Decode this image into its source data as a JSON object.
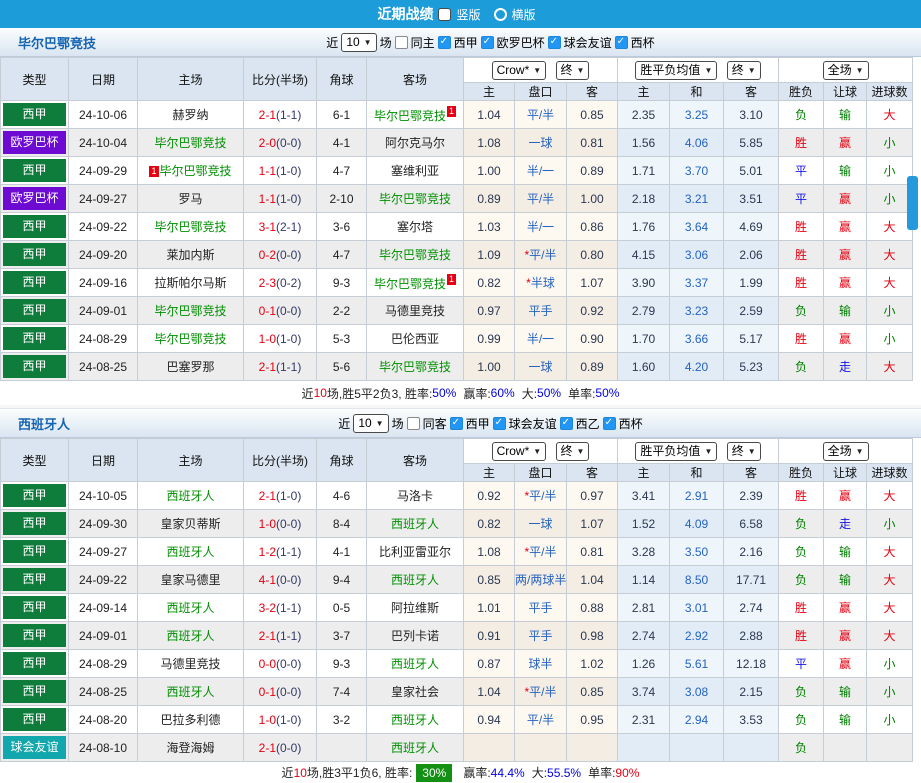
{
  "colors": {
    "type": {
      "西甲": "#0e7c3b",
      "欧罗巴杯": "#6d0bd3",
      "球会友谊": "#12a7ac"
    },
    "result": {
      "胜": "#e60012",
      "平": "#1414e6",
      "负": "#008000",
      "赢": "#e60012",
      "走": "#1414e6",
      "输": "#008000",
      "大": "#e60012",
      "小": "#008000"
    },
    "topbar": "#1c9cd8",
    "checkbox": "#2196f3",
    "team_self": "#009000"
  },
  "topbar": {
    "title": "近期战绩",
    "options": [
      {
        "label": "竖版",
        "selected": true
      },
      {
        "label": "横版",
        "selected": false
      }
    ]
  },
  "table_head": {
    "type": "类型",
    "date": "日期",
    "home": "主场",
    "score": "比分(半场)",
    "corner": "角球",
    "away": "客场",
    "odds_home": "主",
    "odds_handicap": "盘口",
    "odds_away": "客",
    "avg_home": "主",
    "avg_draw": "和",
    "avg_away": "客",
    "res_wdl": "胜负",
    "res_handicap": "让球",
    "res_goals": "进球数"
  },
  "sections": [
    {
      "team": "毕尔巴鄂竞技",
      "filters": {
        "near": "近",
        "count": "10",
        "games": "场",
        "same": "同主",
        "leagues": [
          "西甲",
          "欧罗巴杯",
          "球会友谊",
          "西杯"
        ]
      },
      "selects": {
        "odds": "Crow*",
        "odds_term": "终",
        "avg": "胜平负均值",
        "avg_term": "终",
        "scope": "全场"
      },
      "rows": [
        {
          "type": "西甲",
          "date": "24-10-06",
          "home": "赫罗纳",
          "hs": false,
          "hm": "",
          "score": "2-1",
          "half": "(1-1)",
          "corner": "6-1",
          "away": "毕尔巴鄂竞技",
          "as": true,
          "am": "1",
          "oh": "1.04",
          "hc": "平/半",
          "star": false,
          "oa": "0.85",
          "ah": "2.35",
          "ad": "3.25",
          "aa": "3.10",
          "r1": "负",
          "r2": "输",
          "r3": "大"
        },
        {
          "type": "欧罗巴杯",
          "date": "24-10-04",
          "home": "毕尔巴鄂竞技",
          "hs": true,
          "hm": "",
          "score": "2-0",
          "half": "(0-0)",
          "corner": "4-1",
          "away": "阿尔克马尔",
          "as": false,
          "am": "",
          "oh": "1.08",
          "hc": "一球",
          "star": false,
          "oa": "0.81",
          "ah": "1.56",
          "ad": "4.06",
          "aa": "5.85",
          "r1": "胜",
          "r2": "赢",
          "r3": "小"
        },
        {
          "type": "西甲",
          "date": "24-09-29",
          "home": "毕尔巴鄂竞技",
          "hs": true,
          "hm": "1",
          "score": "1-1",
          "half": "(1-0)",
          "corner": "4-7",
          "away": "塞维利亚",
          "as": false,
          "am": "",
          "oh": "1.00",
          "hc": "半/一",
          "star": false,
          "oa": "0.89",
          "ah": "1.71",
          "ad": "3.70",
          "aa": "5.01",
          "r1": "平",
          "r2": "输",
          "r3": "小"
        },
        {
          "type": "欧罗巴杯",
          "date": "24-09-27",
          "home": "罗马",
          "hs": false,
          "hm": "",
          "score": "1-1",
          "half": "(1-0)",
          "corner": "2-10",
          "away": "毕尔巴鄂竞技",
          "as": true,
          "am": "",
          "oh": "0.89",
          "hc": "平/半",
          "star": false,
          "oa": "1.00",
          "ah": "2.18",
          "ad": "3.21",
          "aa": "3.51",
          "r1": "平",
          "r2": "赢",
          "r3": "小"
        },
        {
          "type": "西甲",
          "date": "24-09-22",
          "home": "毕尔巴鄂竞技",
          "hs": true,
          "hm": "",
          "score": "3-1",
          "half": "(2-1)",
          "corner": "3-6",
          "away": "塞尔塔",
          "as": false,
          "am": "",
          "oh": "1.03",
          "hc": "半/一",
          "star": false,
          "oa": "0.86",
          "ah": "1.76",
          "ad": "3.64",
          "aa": "4.69",
          "r1": "胜",
          "r2": "赢",
          "r3": "大"
        },
        {
          "type": "西甲",
          "date": "24-09-20",
          "home": "莱加内斯",
          "hs": false,
          "hm": "",
          "score": "0-2",
          "half": "(0-0)",
          "corner": "4-7",
          "away": "毕尔巴鄂竞技",
          "as": true,
          "am": "",
          "oh": "1.09",
          "hc": "平/半",
          "star": true,
          "oa": "0.80",
          "ah": "4.15",
          "ad": "3.06",
          "aa": "2.06",
          "r1": "胜",
          "r2": "赢",
          "r3": "大"
        },
        {
          "type": "西甲",
          "date": "24-09-16",
          "home": "拉斯帕尔马斯",
          "hs": false,
          "hm": "",
          "score": "2-3",
          "half": "(0-2)",
          "corner": "9-3",
          "away": "毕尔巴鄂竞技",
          "as": true,
          "am": "1",
          "oh": "0.82",
          "hc": "半球",
          "star": true,
          "oa": "1.07",
          "ah": "3.90",
          "ad": "3.37",
          "aa": "1.99",
          "r1": "胜",
          "r2": "赢",
          "r3": "大"
        },
        {
          "type": "西甲",
          "date": "24-09-01",
          "home": "毕尔巴鄂竞技",
          "hs": true,
          "hm": "",
          "score": "0-1",
          "half": "(0-0)",
          "corner": "2-2",
          "away": "马德里竞技",
          "as": false,
          "am": "",
          "oh": "0.97",
          "hc": "平手",
          "star": false,
          "oa": "0.92",
          "ah": "2.79",
          "ad": "3.23",
          "aa": "2.59",
          "r1": "负",
          "r2": "输",
          "r3": "小"
        },
        {
          "type": "西甲",
          "date": "24-08-29",
          "home": "毕尔巴鄂竞技",
          "hs": true,
          "hm": "",
          "score": "1-0",
          "half": "(1-0)",
          "corner": "5-3",
          "away": "巴伦西亚",
          "as": false,
          "am": "",
          "oh": "0.99",
          "hc": "半/一",
          "star": false,
          "oa": "0.90",
          "ah": "1.70",
          "ad": "3.66",
          "aa": "5.17",
          "r1": "胜",
          "r2": "赢",
          "r3": "小"
        },
        {
          "type": "西甲",
          "date": "24-08-25",
          "home": "巴塞罗那",
          "hs": false,
          "hm": "",
          "score": "2-1",
          "half": "(1-1)",
          "corner": "5-6",
          "away": "毕尔巴鄂竞技",
          "as": true,
          "am": "",
          "oh": "1.00",
          "hc": "一球",
          "star": false,
          "oa": "0.89",
          "ah": "1.60",
          "ad": "4.20",
          "aa": "5.23",
          "r1": "负",
          "r2": "走",
          "r3": "大"
        }
      ],
      "summary": {
        "near": "近",
        "count": "10",
        "rest": "场,胜5平2负3, 胜率:",
        "win_rate": "50%",
        "win_rate_badge": false,
        "win_label": "赢率:",
        "win_pct": "60%",
        "big_label": "大:",
        "big_pct": "50%",
        "single_label": "单率:",
        "single_pct": "50%",
        "single_red": false
      }
    },
    {
      "team": "西班牙人",
      "filters": {
        "near": "近",
        "count": "10",
        "games": "场",
        "same": "同客",
        "leagues": [
          "西甲",
          "球会友谊",
          "西乙",
          "西杯"
        ]
      },
      "selects": {
        "odds": "Crow*",
        "odds_term": "终",
        "avg": "胜平负均值",
        "avg_term": "终",
        "scope": "全场"
      },
      "rows": [
        {
          "type": "西甲",
          "date": "24-10-05",
          "home": "西班牙人",
          "hs": true,
          "hm": "",
          "score": "2-1",
          "half": "(1-0)",
          "corner": "4-6",
          "away": "马洛卡",
          "as": false,
          "am": "",
          "oh": "0.92",
          "hc": "平/半",
          "star": true,
          "oa": "0.97",
          "ah": "3.41",
          "ad": "2.91",
          "aa": "2.39",
          "r1": "胜",
          "r2": "赢",
          "r3": "大"
        },
        {
          "type": "西甲",
          "date": "24-09-30",
          "home": "皇家贝蒂斯",
          "hs": false,
          "hm": "",
          "score": "1-0",
          "half": "(0-0)",
          "corner": "8-4",
          "away": "西班牙人",
          "as": true,
          "am": "",
          "oh": "0.82",
          "hc": "一球",
          "star": false,
          "oa": "1.07",
          "ah": "1.52",
          "ad": "4.09",
          "aa": "6.58",
          "r1": "负",
          "r2": "走",
          "r3": "小"
        },
        {
          "type": "西甲",
          "date": "24-09-27",
          "home": "西班牙人",
          "hs": true,
          "hm": "",
          "score": "1-2",
          "half": "(1-1)",
          "corner": "4-1",
          "away": "比利亚雷亚尔",
          "as": false,
          "am": "",
          "oh": "1.08",
          "hc": "平/半",
          "star": true,
          "oa": "0.81",
          "ah": "3.28",
          "ad": "3.50",
          "aa": "2.16",
          "r1": "负",
          "r2": "输",
          "r3": "大"
        },
        {
          "type": "西甲",
          "date": "24-09-22",
          "home": "皇家马德里",
          "hs": false,
          "hm": "",
          "score": "4-1",
          "half": "(0-0)",
          "corner": "9-4",
          "away": "西班牙人",
          "as": true,
          "am": "",
          "oh": "0.85",
          "hc": "两/两球半",
          "star": false,
          "oa": "1.04",
          "ah": "1.14",
          "ad": "8.50",
          "aa": "17.71",
          "r1": "负",
          "r2": "输",
          "r3": "大"
        },
        {
          "type": "西甲",
          "date": "24-09-14",
          "home": "西班牙人",
          "hs": true,
          "hm": "",
          "score": "3-2",
          "half": "(1-1)",
          "corner": "0-5",
          "away": "阿拉维斯",
          "as": false,
          "am": "",
          "oh": "1.01",
          "hc": "平手",
          "star": false,
          "oa": "0.88",
          "ah": "2.81",
          "ad": "3.01",
          "aa": "2.74",
          "r1": "胜",
          "r2": "赢",
          "r3": "大"
        },
        {
          "type": "西甲",
          "date": "24-09-01",
          "home": "西班牙人",
          "hs": true,
          "hm": "",
          "score": "2-1",
          "half": "(1-1)",
          "corner": "3-7",
          "away": "巴列卡诺",
          "as": false,
          "am": "",
          "oh": "0.91",
          "hc": "平手",
          "star": false,
          "oa": "0.98",
          "ah": "2.74",
          "ad": "2.92",
          "aa": "2.88",
          "r1": "胜",
          "r2": "赢",
          "r3": "大"
        },
        {
          "type": "西甲",
          "date": "24-08-29",
          "home": "马德里竞技",
          "hs": false,
          "hm": "",
          "score": "0-0",
          "half": "(0-0)",
          "corner": "9-3",
          "away": "西班牙人",
          "as": true,
          "am": "",
          "oh": "0.87",
          "hc": "球半",
          "star": false,
          "oa": "1.02",
          "ah": "1.26",
          "ad": "5.61",
          "aa": "12.18",
          "r1": "平",
          "r2": "赢",
          "r3": "小"
        },
        {
          "type": "西甲",
          "date": "24-08-25",
          "home": "西班牙人",
          "hs": true,
          "hm": "",
          "score": "0-1",
          "half": "(0-0)",
          "corner": "7-4",
          "away": "皇家社会",
          "as": false,
          "am": "",
          "oh": "1.04",
          "hc": "平/半",
          "star": true,
          "oa": "0.85",
          "ah": "3.74",
          "ad": "3.08",
          "aa": "2.15",
          "r1": "负",
          "r2": "输",
          "r3": "小"
        },
        {
          "type": "西甲",
          "date": "24-08-20",
          "home": "巴拉多利德",
          "hs": false,
          "hm": "",
          "score": "1-0",
          "half": "(1-0)",
          "corner": "3-2",
          "away": "西班牙人",
          "as": true,
          "am": "",
          "oh": "0.94",
          "hc": "平/半",
          "star": false,
          "oa": "0.95",
          "ah": "2.31",
          "ad": "2.94",
          "aa": "3.53",
          "r1": "负",
          "r2": "输",
          "r3": "小"
        },
        {
          "type": "球会友谊",
          "date": "24-08-10",
          "home": "海登海姆",
          "hs": false,
          "hm": "",
          "score": "2-1",
          "half": "(0-0)",
          "corner": "",
          "away": "西班牙人",
          "as": true,
          "am": "",
          "oh": "",
          "hc": "",
          "star": false,
          "oa": "",
          "ah": "",
          "ad": "",
          "aa": "",
          "r1": "负",
          "r2": "",
          "r3": ""
        }
      ],
      "summary": {
        "near": "近",
        "count": "10",
        "rest": "场,胜3平1负6, 胜率:",
        "win_rate": "30%",
        "win_rate_badge": true,
        "win_label": "赢率:",
        "win_pct": "44.4%",
        "big_label": "大:",
        "big_pct": "55.5%",
        "single_label": "单率:",
        "single_pct": "90%",
        "single_red": true
      }
    }
  ]
}
